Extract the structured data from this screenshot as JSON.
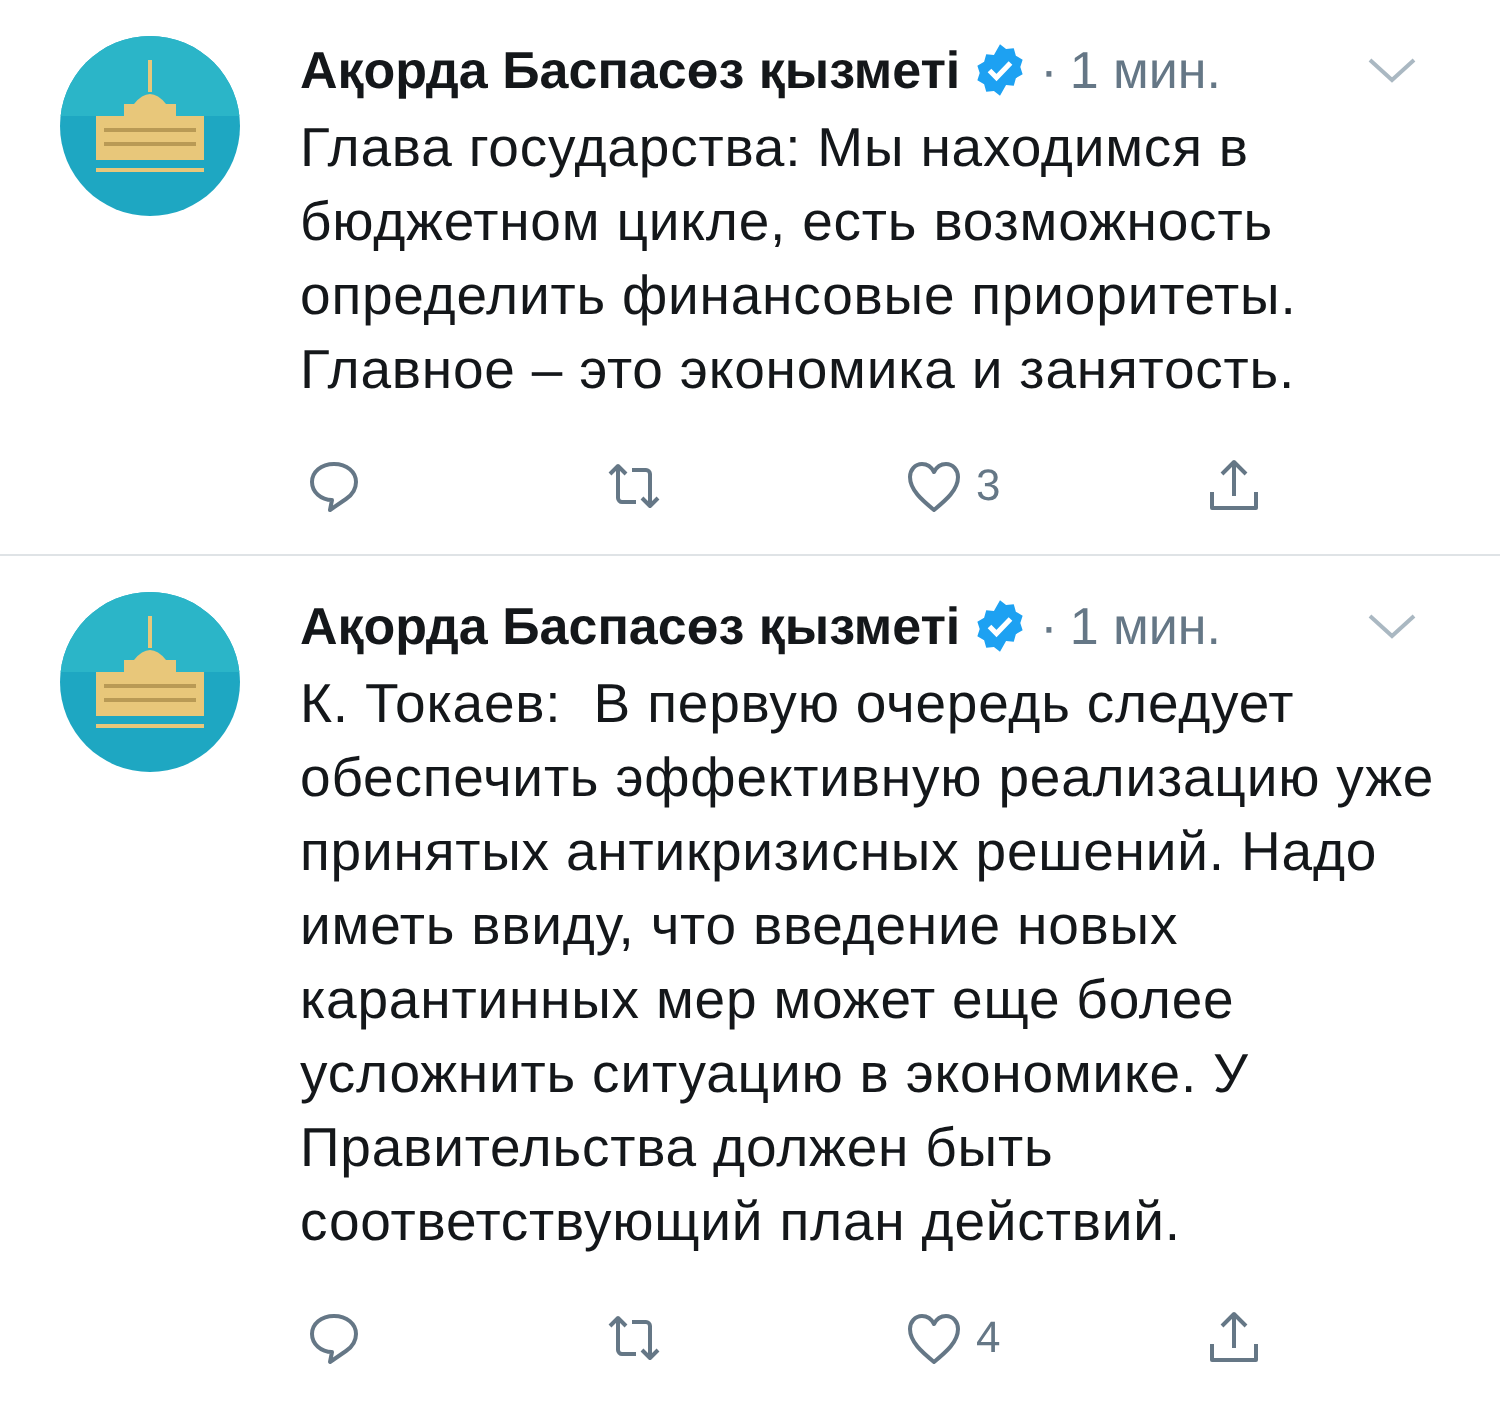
{
  "tweets": [
    {
      "kind": "picture",
      "author": "Ақорда Баспасөз қызметі",
      "verified": true,
      "separator": "·",
      "time": "1 мин.",
      "text": "Глава государства: Мы находимся в бюджетном цикле, есть возможность определить финансовые приоритеты. Главное – это экономика и занятость.",
      "likes": "3"
    },
    {
      "kind": "picture",
      "author": "Ақорда Баспасөз қызметі",
      "verified": true,
      "separator": "·",
      "time": "1 мин.",
      "text": "К. Токаев:  В первую очередь следует обеспечить эффективную реализацию уже принятых антикризисных решений. Надо иметь ввиду, что введение новых карантинных мер может еще более усложнить ситуацию в экономике. У Правительства должен быть соответствующий план действий.",
      "likes": "4"
    }
  ]
}
